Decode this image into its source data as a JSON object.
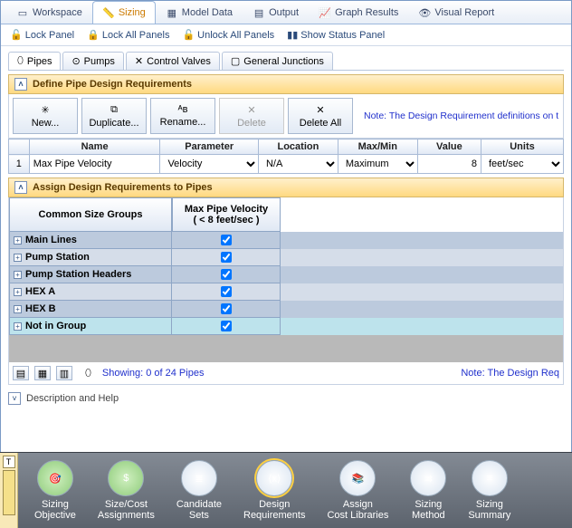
{
  "main_tabs": {
    "workspace": "Workspace",
    "sizing": "Sizing",
    "model_data": "Model Data",
    "output": "Output",
    "graph": "Graph Results",
    "visual": "Visual Report"
  },
  "lock_bar": {
    "lock": "Lock Panel",
    "lock_all": "Lock All Panels",
    "unlock_all": "Unlock All Panels",
    "status": "Show Status Panel"
  },
  "sub_tabs": {
    "pipes": "Pipes",
    "pumps": "Pumps",
    "cv": "Control Valves",
    "gj": "General Junctions"
  },
  "section1": {
    "title": "Define Pipe Design Requirements"
  },
  "buttons": {
    "new": "New...",
    "dup": "Duplicate...",
    "ren": "Rename...",
    "del": "Delete",
    "del_all": "Delete All"
  },
  "note1": "Note: The Design Requirement definitions on t",
  "cols": {
    "row": " ",
    "name": "Name",
    "param": "Parameter",
    "loc": "Location",
    "mm": "Max/Min",
    "val": "Value",
    "units": "Units"
  },
  "row1": {
    "idx": "1",
    "name": "Max Pipe Velocity",
    "param": "Velocity",
    "loc": "N/A",
    "mm": "Maximum",
    "val": "8",
    "units": "feet/sec"
  },
  "section2": {
    "title": "Assign Design Requirements to Pipes"
  },
  "assign_head": {
    "groups": "Common Size Groups",
    "col": "Max Pipe Velocity\n( < 8 feet/sec )"
  },
  "groups": {
    "g1": "Main Lines",
    "g2": "Pump Station",
    "g3": "Pump Station Headers",
    "g4": "HEX A",
    "g5": "HEX B",
    "g6": "Not in Group"
  },
  "showing": "Showing: 0 of 24 Pipes",
  "note2": "Note: The Design Req",
  "desc": "Description and Help",
  "bottom": {
    "b1": "Sizing\nObjective",
    "b2": "Size/Cost\nAssignments",
    "b3": "Candidate\nSets",
    "b4": "Design\nRequirements",
    "b5": "Assign\nCost Libraries",
    "b6": "Sizing\nMethod",
    "b7": "Sizing\nSummary"
  }
}
